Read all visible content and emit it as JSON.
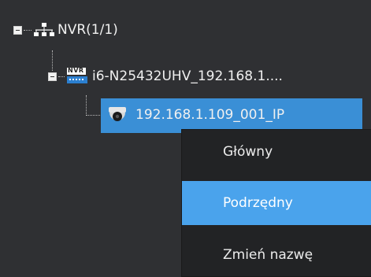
{
  "tree": {
    "root_label": "NVR(1/1)",
    "device_label": "i6-N25432UHV_192.168.1....",
    "device_icon_text": "NVR",
    "camera_label": "192.168.1.109_001_IP"
  },
  "context_menu": {
    "items": [
      {
        "label": "Główny"
      },
      {
        "label": "Podrzędny"
      },
      {
        "label": "Zmień nazwę"
      }
    ]
  },
  "colors": {
    "background": "#2f3033",
    "selection": "#3a8fd6",
    "menu_background": "#222325",
    "menu_hover": "#4aa3ec"
  }
}
